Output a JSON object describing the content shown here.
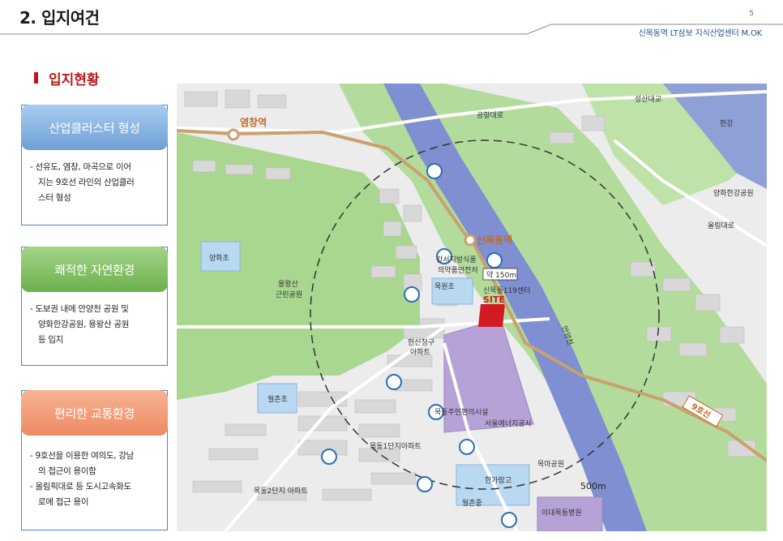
{
  "header": {
    "title": "2. 입지여건",
    "page_number": "5",
    "subtitle": "신목동역 LT삼보 지식산업센터 M.OK"
  },
  "section_title": "입지현황",
  "cards": [
    {
      "title": "산업클러스터 형성",
      "lines": [
        "- 선유도, 염창, 마곡으로 이어",
        "  지는 9호선 라인의 산업클러",
        "  스터 형성"
      ]
    },
    {
      "title": "쾌적한 자연환경",
      "lines": [
        "- 도보권 내에 안양천 공원 및",
        "  양화한강공원, 용왕산 공원",
        "  등 입지"
      ]
    },
    {
      "title": "편리한 교통환경",
      "lines": [
        "- 9호선을 이용한 여의도, 강남",
        "  의 접근이 용이함",
        "- 올림픽대로 등 도시고속화도",
        "  로에 접근 용이"
      ]
    }
  ],
  "map": {
    "labels": {
      "yeomchang": "염창역",
      "sinmokdong": "신목동역",
      "gonghang": "공항대로",
      "seongsan": "성산대교",
      "hangang": "한강",
      "yanghwa_park": "양화한강공원",
      "olympic": "올림대로",
      "yanghwa_school": "양화초",
      "yongwangsan": "용왕산",
      "yongwangsan2": "근린공원",
      "mokwon": "목원초",
      "firestation1": "강서지방식품",
      "firestation2": "의약품안전처",
      "firestation3": "신목동119센터",
      "distance": "약 150m",
      "site": "SITE",
      "hanshin1": "한신청구",
      "hanshin2": "아파트",
      "anyangcheon": "안양천",
      "wolchon": "월촌초",
      "seoul_energy": "서울에너지공사",
      "mokdong_facility": "목동주민편의시설",
      "mokdong_apt1": "목동1단지아파트",
      "mokdong_apt2": "목동2단지 아파트",
      "mokma_park": "목마공원",
      "hangaram": "한가람고",
      "wolchon_mid": "월촌중",
      "ewha": "이대목동병원",
      "line9": "9호선",
      "dist500": "500m"
    }
  }
}
